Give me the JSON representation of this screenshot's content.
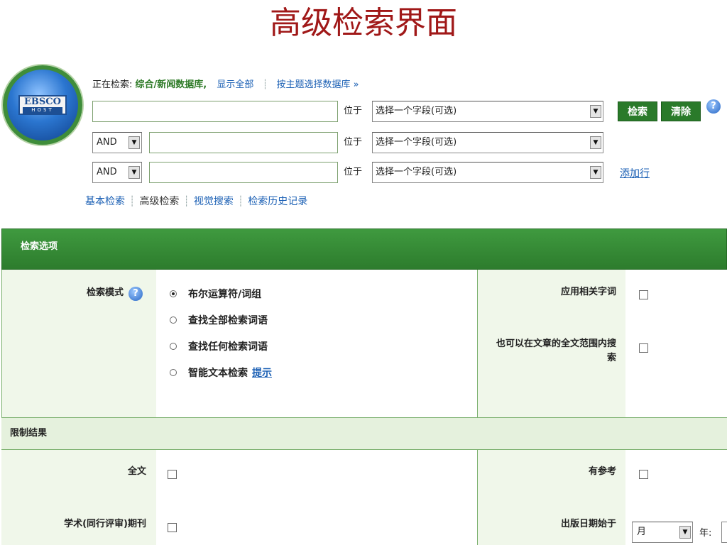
{
  "slide": {
    "title": "高级检索界面"
  },
  "logo": {
    "brand": "EBSCO",
    "host": "HOST"
  },
  "search_scope": {
    "prefix": "正在检索: ",
    "databases": "综合/新闻数据库,",
    "show_all": "显示全部",
    "by_subject": "按主题选择数据库 »"
  },
  "query_rows": [
    {
      "operator": "",
      "value": "",
      "in_label": "位于",
      "field": "选择一个字段(可选)"
    },
    {
      "operator": "AND",
      "value": "",
      "in_label": "位于",
      "field": "选择一个字段(可选)"
    },
    {
      "operator": "AND",
      "value": "",
      "in_label": "位于",
      "field": "选择一个字段(可选)"
    }
  ],
  "buttons": {
    "search": "检索",
    "clear": "清除",
    "add_row": "添加行",
    "help": "?"
  },
  "search_tabs": [
    "基本检索",
    "高级检索",
    "视觉搜索",
    "检索历史记录"
  ],
  "options": {
    "header": "检索选项",
    "mode_label": "检索模式",
    "modes": [
      "布尔运算符/词组",
      "查找全部检索词语",
      "查找任何检索词语",
      "智能文本检索"
    ],
    "mode_hint": "提示",
    "selected_mode": 0,
    "related_words": "应用相关字词",
    "fulltext_search": "也可以在文章的全文范围内搜索"
  },
  "limits": {
    "header": "限制结果",
    "full_text": "全文",
    "has_references": "有参考",
    "peer_reviewed": "学术(同行评审)期刊",
    "pub_date_from": "出版日期始于",
    "month": "月",
    "year_label": "年:"
  },
  "colors": {
    "green": "#2d7c2d",
    "link": "#1a5fb4",
    "title": "#a01818"
  }
}
